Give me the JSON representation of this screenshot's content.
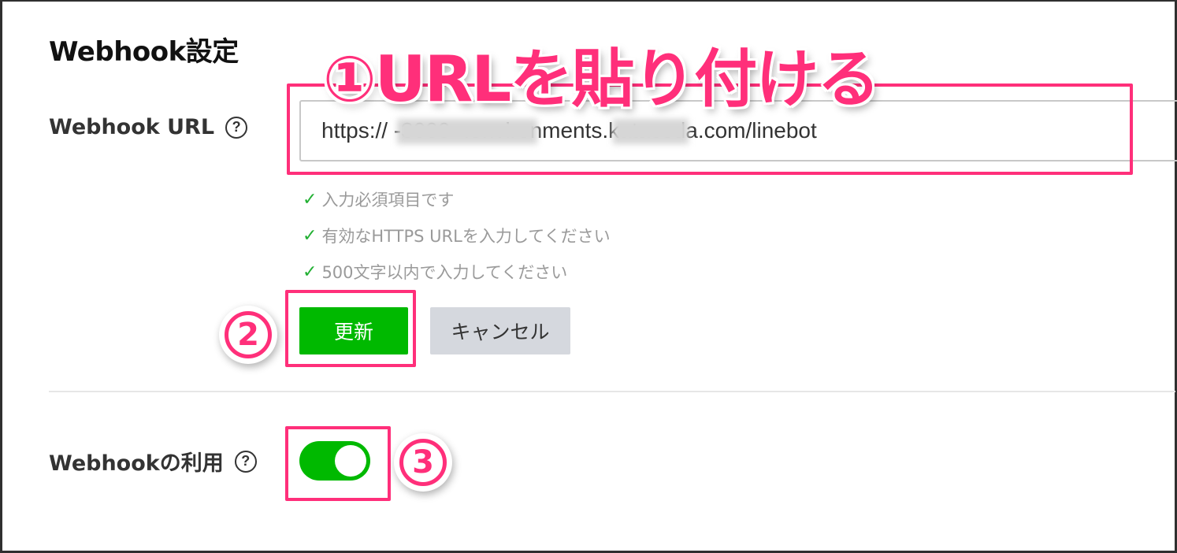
{
  "section": {
    "title": "Webhook設定"
  },
  "webhook_url": {
    "label": "Webhook URL",
    "help_icon": "question-circle-icon",
    "value": "https://                  -3000-              .environments.katacoda.com/linebot",
    "validations": [
      "入力必須項目です",
      "有効なHTTPS URLを入力してください",
      "500文字以内で入力してください"
    ]
  },
  "buttons": {
    "update": "更新",
    "cancel": "キャンセル"
  },
  "use_webhook": {
    "label": "Webhookの利用",
    "help_icon": "question-circle-icon",
    "enabled": true
  },
  "annotations": {
    "step1": "①URLを貼り付ける",
    "step2": "2",
    "step3": "3",
    "color": "#ff2f7a"
  },
  "colors": {
    "accent": "#00b900",
    "check": "#22b033"
  }
}
